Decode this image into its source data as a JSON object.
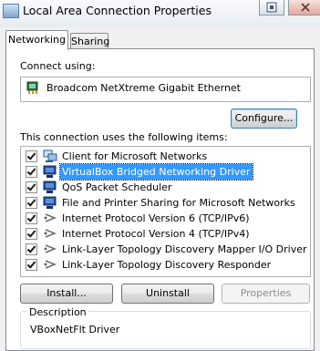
{
  "window": {
    "title": "Local Area Connection Properties"
  },
  "tabs": [
    {
      "label": "Networking",
      "active": true
    },
    {
      "label": "Sharing",
      "active": false
    }
  ],
  "connect_using": {
    "label": "Connect using:",
    "adapter": "Broadcom NetXtreme Gigabit Ethernet",
    "adapter_icon": "network-adapter-icon",
    "configure_label": "Configure..."
  },
  "items_section": {
    "label": "This connection uses the following items:",
    "items": [
      {
        "label": "Client for Microsoft Networks",
        "checked": true,
        "selected": false,
        "icon": "network-client-icon"
      },
      {
        "label": "VirtualBox Bridged Networking Driver",
        "checked": true,
        "selected": true,
        "icon": "network-service-icon"
      },
      {
        "label": "QoS Packet Scheduler",
        "checked": true,
        "selected": false,
        "icon": "network-service-icon"
      },
      {
        "label": "File and Printer Sharing for Microsoft Networks",
        "checked": true,
        "selected": false,
        "icon": "network-service-icon"
      },
      {
        "label": "Internet Protocol Version 6 (TCP/IPv6)",
        "checked": true,
        "selected": false,
        "icon": "protocol-icon"
      },
      {
        "label": "Internet Protocol Version 4 (TCP/IPv4)",
        "checked": true,
        "selected": false,
        "icon": "protocol-icon"
      },
      {
        "label": "Link-Layer Topology Discovery Mapper I/O Driver",
        "checked": true,
        "selected": false,
        "icon": "protocol-icon"
      },
      {
        "label": "Link-Layer Topology Discovery Responder",
        "checked": true,
        "selected": false,
        "icon": "protocol-icon"
      }
    ]
  },
  "buttons": {
    "install": "Install...",
    "uninstall": "Uninstall",
    "properties": "Properties"
  },
  "description": {
    "label": "Description",
    "text": "VBoxNetFlt Driver"
  },
  "colors": {
    "selection": "#3399ff",
    "panel_border": "#898c95",
    "window_bg": "#f0f0f0"
  }
}
